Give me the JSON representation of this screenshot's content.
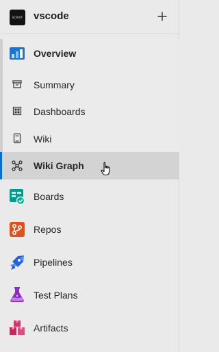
{
  "header": {
    "avatar_text": "SCRIVT",
    "project_name": "vscode",
    "add_symbol": "+"
  },
  "nav": {
    "overview": "Overview",
    "summary": "Summary",
    "dashboards": "Dashboards",
    "wiki": "Wiki",
    "wiki_graph": "Wiki Graph",
    "boards": "Boards",
    "repos": "Repos",
    "pipelines": "Pipelines",
    "test_plans": "Test Plans",
    "artifacts": "Artifacts"
  },
  "colors": {
    "accent": "#0b6ed1",
    "boards": "#019b8f",
    "repos": "#e0501b",
    "pipelines": "#2560e0",
    "test_plans": "#8a2ec2",
    "artifacts": "#d6336b"
  },
  "icons": {
    "overview": "overview-icon",
    "summary": "summary-icon",
    "dashboards": "dashboards-icon",
    "wiki": "wiki-icon",
    "wiki_graph": "wiki-graph-icon",
    "boards": "boards-icon",
    "repos": "repos-icon",
    "pipelines": "pipelines-icon",
    "test_plans": "test-plans-icon",
    "artifacts": "artifacts-icon"
  }
}
